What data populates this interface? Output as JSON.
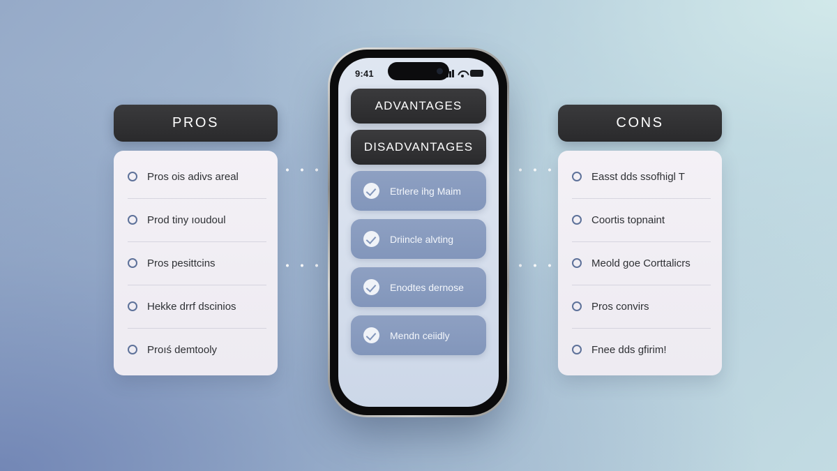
{
  "background": {
    "gradient_from": "#96aac8",
    "gradient_to": "#c2dbe2",
    "accent_cyan": "#cbe3e6",
    "accent_blue": "#7789b5"
  },
  "left_panel": {
    "header": "PROS",
    "bullet_icon": "circle-outline-icon",
    "items": [
      {
        "text": "Pros ois adivs areal"
      },
      {
        "text": "Prod tiny ıoudoul"
      },
      {
        "text": "Pros pesittcins"
      },
      {
        "text": "Hekke drrf dscinios"
      },
      {
        "text": "Proıś demtooly"
      }
    ]
  },
  "right_panel": {
    "header": "CONS",
    "bullet_icon": "circle-outline-icon",
    "items": [
      {
        "text": "Easst dds ssofhigl T"
      },
      {
        "text": "Coortis topnaint"
      },
      {
        "text": "Meold goe Corttalicrs"
      },
      {
        "text": "Pros convirs"
      },
      {
        "text": "Fnee dds gfirim!"
      }
    ]
  },
  "phone": {
    "status_bar": {
      "time": "9:41",
      "signal_icon": "cellular-bars-icon",
      "wifi_icon": "wifi-icon",
      "battery_icon": "battery-icon"
    },
    "buttons": [
      {
        "label": "ADVANTAGES"
      },
      {
        "label": "DISADVANTAGES"
      }
    ],
    "rows": [
      {
        "text": "Etrlere ihg Maim",
        "icon": "check-circle-icon"
      },
      {
        "text": "Driincle alvting",
        "icon": "check-circle-icon"
      },
      {
        "text": "Enodtes dernose",
        "icon": "check-circle-icon"
      },
      {
        "text": "Mendn ceiidly",
        "icon": "check-circle-icon"
      }
    ]
  },
  "connectors": {
    "style": "dotted-white",
    "count": 4
  }
}
